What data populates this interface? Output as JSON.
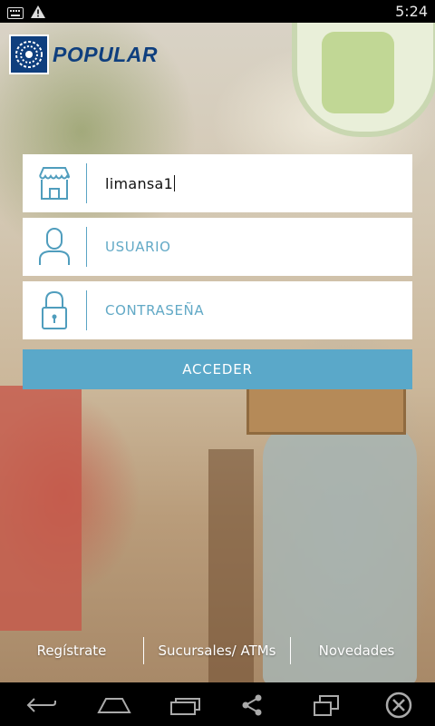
{
  "status_bar": {
    "time": "5:24",
    "icons": [
      "keyboard-icon",
      "warning-icon"
    ]
  },
  "brand": {
    "name": "POPULAR",
    "primary_color": "#0f3f7e",
    "accent_color": "#5aa8c9"
  },
  "login": {
    "company_field": {
      "value": "limansa1",
      "icon": "store-icon"
    },
    "user_field": {
      "placeholder": "USUARIO",
      "icon": "user-icon"
    },
    "password_field": {
      "placeholder": "CONTRASEÑA",
      "icon": "lock-icon"
    },
    "submit_label": "ACCEDER"
  },
  "bottom_links": [
    {
      "label": "Regístrate"
    },
    {
      "label": "Sucursales/ ATMs"
    },
    {
      "label": "Novedades"
    }
  ],
  "nav_bar": {
    "icons": [
      "back-icon",
      "home-icon",
      "recents-icon",
      "share-icon",
      "screenshot-icon",
      "close-icon"
    ]
  }
}
